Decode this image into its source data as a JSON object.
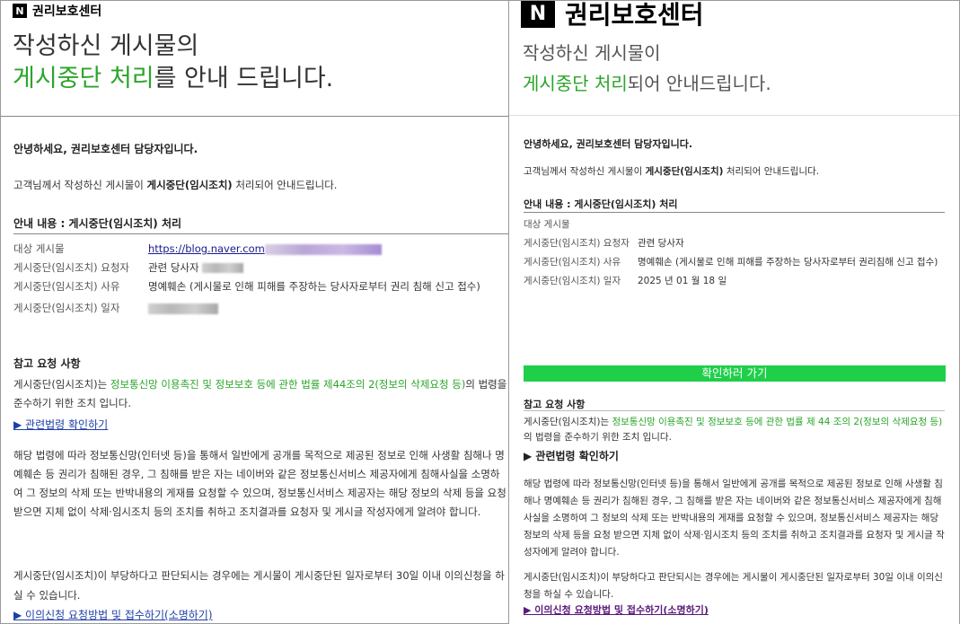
{
  "left": {
    "brand": {
      "logo": "N",
      "name": "권리보호센터"
    },
    "headline": {
      "line1": "작성하신 게시물의",
      "line2_green": "게시중단 처리",
      "line2_rest": "를 안내 드립니다."
    },
    "greeting": "안녕하세요, 권리보호센터 담당자입니다.",
    "intro": {
      "before": "고객님께서 작성하신 게시물이 ",
      "highlight": "게시중단(임시조치)",
      "after": " 처리되어 안내드립니다."
    },
    "section1_title": "안내 내용 : 게시중단(임시조치) 처리",
    "table": {
      "post_label": "대상 게시물",
      "post_url": "https://blog.naver.com",
      "requester_label": "게시중단(임시조치) 요청자",
      "requester_value": "관련 당사자",
      "reason_label": "게시중단(임시조치) 사유",
      "reason_value": "명예훼손 (게시물로 인해 피해를 주장하는 당사자로부터 권리 침해 신고 접수)",
      "date_label": "게시중단(임시조치) 일자"
    },
    "section2_title": "참고 요청 사항",
    "notice": {
      "before": "게시중단(임시조치)는 ",
      "highlight": "정보통신망 이용촉진 및 정보보호 등에 관한 법률 제44조의 2(정보의 삭제요청 등)",
      "after": "의 법령을 준수하기 위한 조치 입니다."
    },
    "law_link": "▶ 관련법령 확인하기",
    "para1": "해당 법령에 따라 정보통신망(인터넷 등)을 통해서 일반에게 공개를 목적으로 제공된 정보로 인해 사생활 침해나 명예훼손 등 권리가 침해된 경우, 그 침해를 받은 자는 네이버와 같은 정보통신서비스 제공자에게 침해사실을 소명하여 그 정보의 삭제 또는 반박내용의 게재를 요청할 수 있으며, 정보통신서비스 제공자는 해당 정보의 삭제 등을 요청 받으면 지체 없이 삭제·임시조치 등의 조치를 취하고 조치결과를 요청자 및 게시글 작성자에게 알려야 합니다.",
    "para2": "게시중단(임시조치)이 부당하다고 판단되시는 경우에는 게시물이 게시중단된 일자로부터 30일 이내 이의신청을 하실 수 있습니다.",
    "appeal_link": "▶ 이의신청 요청방법 및 접수하기(소명하기)"
  },
  "right": {
    "brand": {
      "logo": "N",
      "name": "권리보호센터"
    },
    "headline": {
      "line1": "작성하신 게시물이",
      "line2_green": "게시중단 처리",
      "line2_rest": "되어 안내드립니다."
    },
    "greeting": "안녕하세요, 권리보호센터 담당자입니다.",
    "intro": {
      "before": "고객님께서 작성하신 게시물이 ",
      "highlight": "게시중단(임시조치)",
      "after": " 처리되어 안내드립니다."
    },
    "section1_title": "안내 내용 : 게시중단(임시조치) 처리",
    "table": {
      "post_label": "대상 게시물",
      "requester_label": "게시중단(임시조치) 요청자",
      "requester_value": "관련 당사자",
      "reason_label": "게시중단(임시조치) 사유",
      "reason_value": "명예훼손 (게시물로 인해 피해를 주장하는 당사자로부터 권리침해 신고 접수)",
      "date_label": "게시중단(임시조치) 일자",
      "date_value": "2025 년 01 월 18 일"
    },
    "confirm_button": "확인하러 가기",
    "section2_title": "참고 요청 사항",
    "notice": {
      "before": "게시중단(임시조치)는 ",
      "highlight": "정보통신망 이용촉진 및 정보보호 등에 관한 법률 제 44 조의 2(정보의 삭제요청 등)",
      "after": "의 법령을 준수하기 위한 조치 입니다."
    },
    "law_link": "▶ 관련법령 확인하기",
    "para1": "해당 법령에 따라 정보통신망(인터넷 등)을 통해서 일반에게 공개를 목적으로 제공된 정보로 인해 사생활 침해나 명예훼손 등 권리가 침해된 경우, 그 침해를 받은 자는 네이버와 같은 정보통신서비스 제공자에게 침해사실을 소명하여 그 정보의 삭제 또는 반박내용의 게재를 요청할 수 있으며, 정보통신서비스 제공자는 해당 정보의 삭제 등을 요청 받으면 지체 없이 삭제·임시조치 등의 조치를 취하고 조치결과를 요청자 및 게시글 작성자에게 알려야 합니다.",
    "para2": "게시중단(임시조치)이 부당하다고 판단되시는 경우에는 게시물이 게시중단된 일자로부터 30일 이내 이의신청을 하실 수 있습니다.",
    "appeal_link": "▶ 이의신청 요청방법 및 접수하기(소명하기)"
  }
}
